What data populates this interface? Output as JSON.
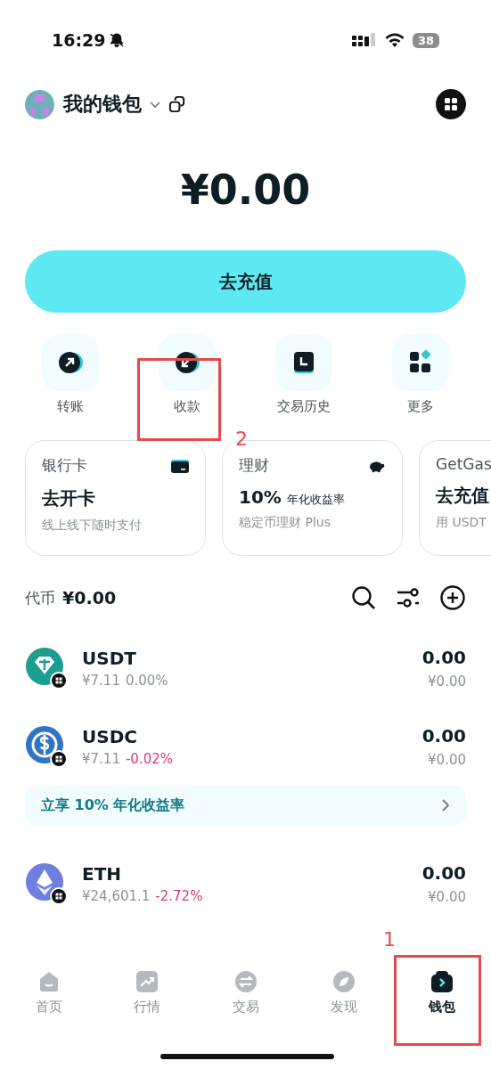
{
  "status_bar": {
    "time": "16:29",
    "battery": "38"
  },
  "header": {
    "wallet_name": "我的钱包"
  },
  "balance": "¥0.00",
  "deposit_button": "去充值",
  "actions": [
    {
      "kind": "send",
      "label": "转账"
    },
    {
      "kind": "receive",
      "label": "收款"
    },
    {
      "kind": "history",
      "label": "交易历史"
    },
    {
      "kind": "more",
      "label": "更多"
    }
  ],
  "cards": [
    {
      "kind": "card",
      "title": "银行卡",
      "headline": "去开卡",
      "subtitle": "线上线下随时支付"
    },
    {
      "kind": "finance",
      "title": "理财",
      "headline": "10%",
      "headline_note": "年化收益率",
      "subtitle": "稳定币理财 Plus"
    },
    {
      "kind": "none",
      "title": "GetGas",
      "headline": "去充值",
      "subtitle": "用 USDT"
    }
  ],
  "tokens_header": {
    "label": "代币",
    "total": "¥0.00"
  },
  "tokens": [
    {
      "kind": "tether",
      "symbol": "USDT",
      "price": "¥7.11",
      "change": "0.00%",
      "negative": false,
      "color": "#1a9e8f",
      "amount": "0.00",
      "value": "¥0.00"
    },
    {
      "kind": "usdc",
      "symbol": "USDC",
      "price": "¥7.11",
      "change": "-0.02%",
      "negative": true,
      "color": "#2f74c8",
      "amount": "0.00",
      "value": "¥0.00"
    },
    {
      "kind": "banner",
      "text": "立享 10% 年化收益率"
    },
    {
      "kind": "eth",
      "symbol": "ETH",
      "price": "¥24,601.1",
      "change": "-2.72%",
      "negative": true,
      "color": "#6e7fe0",
      "amount": "0.00",
      "value": "¥0.00"
    }
  ],
  "tab_bar": [
    {
      "kind": "home",
      "label": "首页",
      "selected": false
    },
    {
      "kind": "market",
      "label": "行情",
      "selected": false
    },
    {
      "kind": "trade",
      "label": "交易",
      "selected": false
    },
    {
      "kind": "discover",
      "label": "发现",
      "selected": false
    },
    {
      "kind": "wallet",
      "label": "钱包",
      "selected": true
    }
  ],
  "annotations": [
    {
      "kind": "receive",
      "number": "2"
    },
    {
      "kind": "tab",
      "number": "1"
    }
  ]
}
